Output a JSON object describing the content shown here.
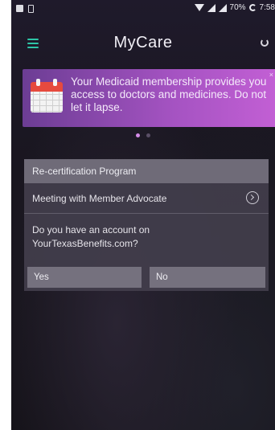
{
  "status_bar": {
    "battery_text": "70%",
    "time": "7:58"
  },
  "header": {
    "logo_text": "MyCare"
  },
  "banner": {
    "message": "Your Medicaid membership provides you access to doctors and medicines. Do not let it lapse.",
    "close_label": "×"
  },
  "carousel": {
    "page_count": 2,
    "active_index": 0
  },
  "card": {
    "title": "Re-certification Program",
    "meeting_label": "Meeting with Member Advocate",
    "question": "Do you have an account on YourTexasBenefits.com?",
    "yes_label": "Yes",
    "no_label": "No"
  },
  "colors": {
    "accent": "#2ec4a6",
    "banner_start": "#6c3d94",
    "banner_end": "#c25fd4",
    "calendar_red": "#e64a3e"
  }
}
